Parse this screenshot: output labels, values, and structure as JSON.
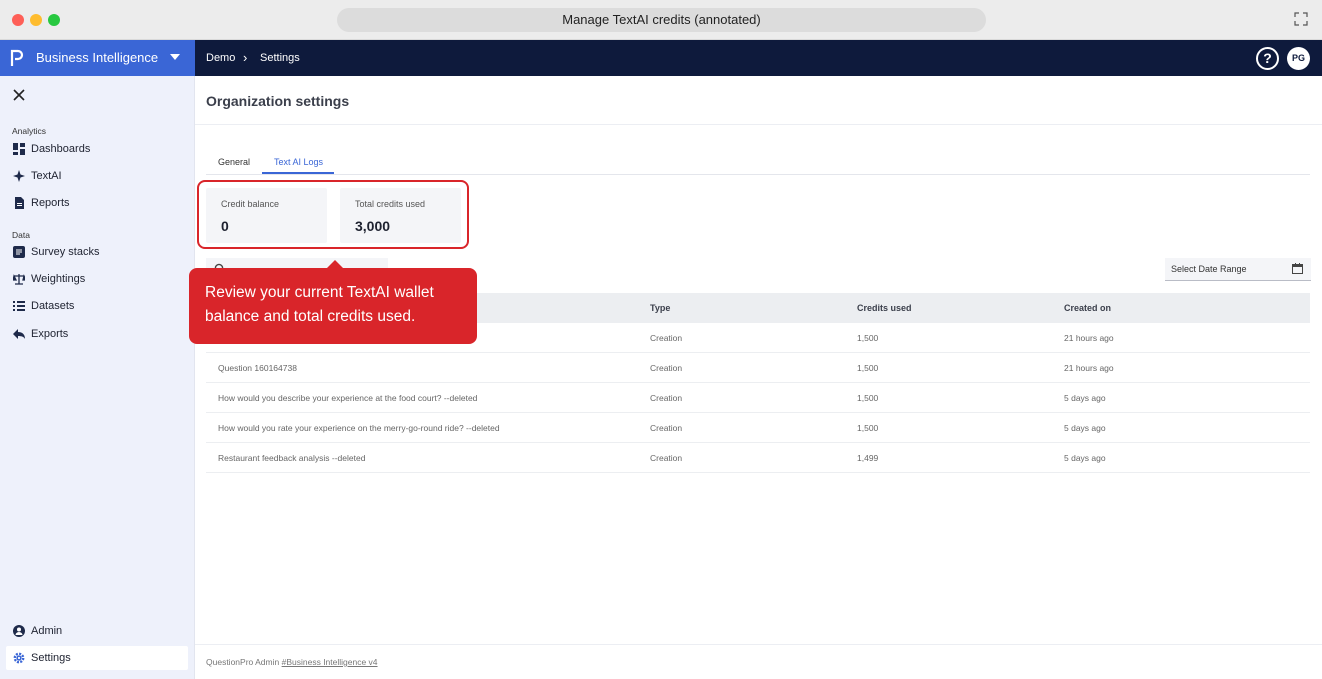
{
  "window": {
    "title": "Manage TextAI credits (annotated)"
  },
  "app": {
    "brand": "Business Intelligence"
  },
  "breadcrumb": {
    "items": [
      "Demo",
      "Settings"
    ],
    "separator": "›"
  },
  "header": {
    "help_label": "?",
    "avatar_initials": "PG"
  },
  "sidebar": {
    "sections": [
      {
        "label": "Analytics",
        "items": [
          {
            "label": "Dashboards",
            "icon": "dashboard-icon"
          },
          {
            "label": "TextAI",
            "icon": "sparkle-icon"
          },
          {
            "label": "Reports",
            "icon": "report-icon"
          }
        ]
      },
      {
        "label": "Data",
        "items": [
          {
            "label": "Survey stacks",
            "icon": "stack-icon"
          },
          {
            "label": "Weightings",
            "icon": "scale-icon"
          },
          {
            "label": "Datasets",
            "icon": "list-icon"
          },
          {
            "label": "Exports",
            "icon": "export-icon"
          }
        ]
      }
    ],
    "bottom_items": [
      {
        "label": "Admin",
        "icon": "admin-icon"
      },
      {
        "label": "Settings",
        "icon": "gear-icon",
        "active": true
      }
    ]
  },
  "page": {
    "title": "Organization settings",
    "tabs": [
      {
        "label": "General"
      },
      {
        "label": "Text AI Logs",
        "active": true
      }
    ]
  },
  "cards": [
    {
      "label": "Credit balance",
      "value": "0"
    },
    {
      "label": "Total credits used",
      "value": "3,000"
    }
  ],
  "filters": {
    "date_range_label": "Select Date Range"
  },
  "table": {
    "columns": [
      "",
      "Type",
      "Credits used",
      "Created on"
    ],
    "rows": [
      [
        "",
        "Creation",
        "1,500",
        "21 hours ago"
      ],
      [
        "Question 160164738",
        "Creation",
        "1,500",
        "21 hours ago"
      ],
      [
        "How would you describe your experience at the food court? --deleted",
        "Creation",
        "1,500",
        "5 days ago"
      ],
      [
        "How would you rate your experience on the merry-go-round ride? --deleted",
        "Creation",
        "1,500",
        "5 days ago"
      ],
      [
        "Restaurant feedback analysis --deleted",
        "Creation",
        "1,499",
        "5 days ago"
      ]
    ]
  },
  "footer": {
    "text": "QuestionPro Admin",
    "link": "#Business Intelligence v4"
  },
  "callout": {
    "text": "Review your current TextAI wallet balance and total credits used."
  },
  "colors": {
    "accent": "#3a66d6",
    "topbar": "#0e1a3c",
    "callout": "#d9252a"
  }
}
